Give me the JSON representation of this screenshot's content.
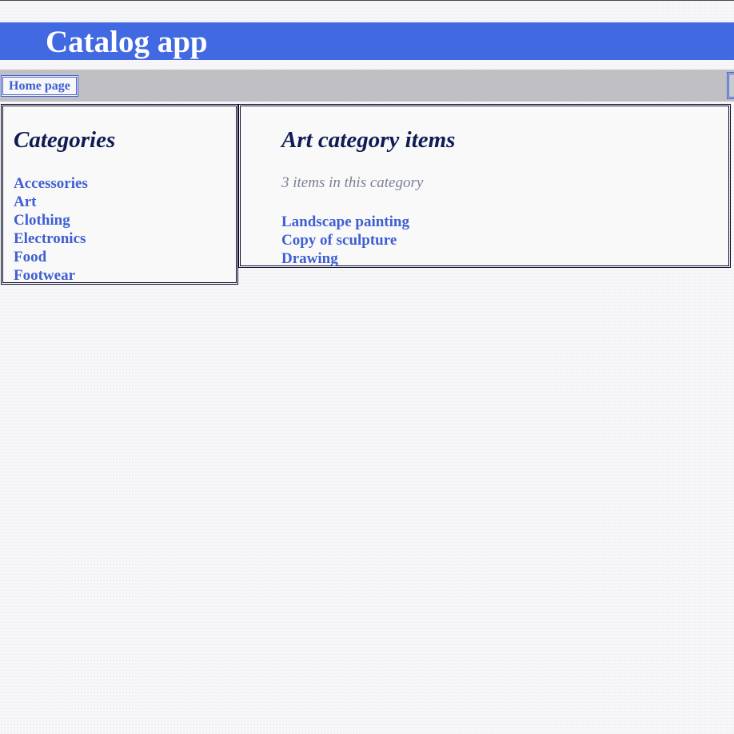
{
  "header": {
    "title": "Catalog app",
    "background_color": "#4169e1"
  },
  "nav": {
    "home_label": "Home page"
  },
  "sidebar": {
    "heading": "Categories",
    "categories": [
      "Accessories",
      "Art",
      "Clothing",
      "Electronics",
      "Food",
      "Footwear"
    ]
  },
  "main": {
    "heading": "Art category items",
    "count_text": "3 items in this category",
    "items": [
      "Landscape painting",
      "Copy of sculpture",
      "Drawing"
    ]
  },
  "colors": {
    "link": "#3f5fd0",
    "heading": "#0f1b52",
    "navbar": "#c0c0c4"
  }
}
